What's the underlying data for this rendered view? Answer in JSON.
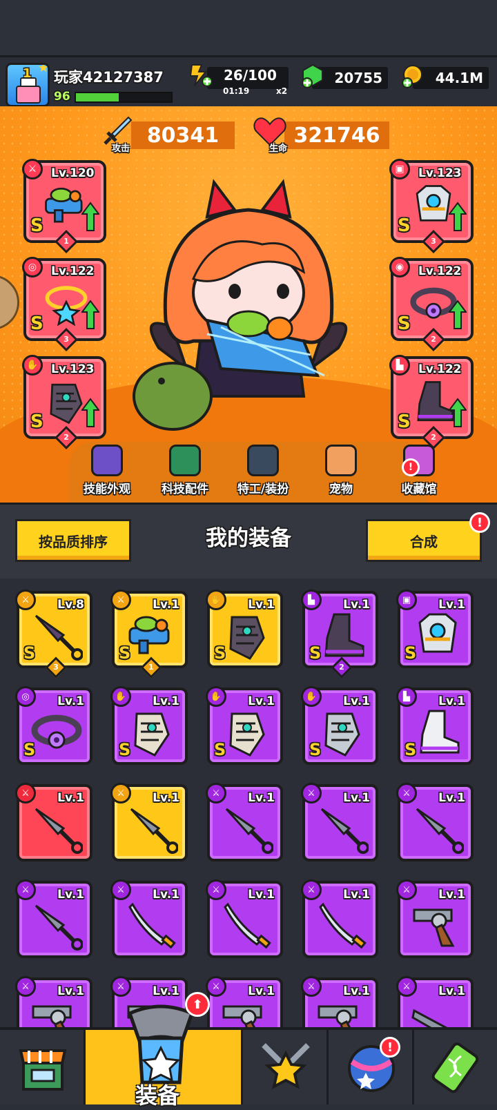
{
  "player": {
    "name": "玩家42127387",
    "level": "96",
    "xp_fraction": 0.45,
    "avatar_level": "1"
  },
  "resources": {
    "energy": {
      "value": "26/100",
      "timer": "01:19",
      "multiplier": "x2"
    },
    "gems": {
      "value": "20755"
    },
    "coins": {
      "value": "44.1M"
    }
  },
  "stats": {
    "attack": {
      "value": "80341",
      "label": "攻击"
    },
    "hp": {
      "value": "321746",
      "label": "生命"
    }
  },
  "equipped": [
    {
      "slot": "weapon",
      "level": "Lv.120",
      "grade": "S",
      "stars": "1",
      "icon": "water-gun-icon",
      "cat_icon": "sword-icon"
    },
    {
      "slot": "necklace",
      "level": "Lv.122",
      "grade": "S",
      "stars": "3",
      "icon": "star-necklace-icon",
      "cat_icon": "necklace-icon"
    },
    {
      "slot": "gloves",
      "level": "Lv.123",
      "grade": "S",
      "stars": "2",
      "icon": "gauntlet-icon",
      "cat_icon": "glove-icon"
    },
    {
      "slot": "armor",
      "level": "Lv.123",
      "grade": "S",
      "stars": "3",
      "icon": "mech-armor-icon",
      "cat_icon": "shirt-icon"
    },
    {
      "slot": "belt",
      "level": "Lv.122",
      "grade": "S",
      "stars": "2",
      "icon": "belt-icon",
      "cat_icon": "belt-icon"
    },
    {
      "slot": "boots",
      "level": "Lv.122",
      "grade": "S",
      "stars": "2",
      "icon": "boot-icon",
      "cat_icon": "boot-icon"
    }
  ],
  "menu": [
    {
      "label": "技能外观",
      "icon": "skill-skin-icon"
    },
    {
      "label": "科技配件",
      "icon": "tech-part-icon"
    },
    {
      "label": "特工/装扮",
      "icon": "agent-icon"
    },
    {
      "label": "宠物",
      "icon": "pet-icon"
    },
    {
      "label": "收藏馆",
      "icon": "collection-icon"
    }
  ],
  "equipment_panel": {
    "sort_label": "按品质排序",
    "title": "我的装备",
    "merge_label": "合成",
    "merge_alert": "!"
  },
  "inventory": [
    {
      "level": "Lv.8",
      "rarity": "gold",
      "grade": "S",
      "stars": "3",
      "icon": "dark-kunai-icon"
    },
    {
      "level": "Lv.1",
      "rarity": "gold",
      "grade": "S",
      "stars": "1",
      "icon": "water-gun-icon"
    },
    {
      "level": "Lv.1",
      "rarity": "gold",
      "grade": "S",
      "stars": "",
      "icon": "gauntlet-icon"
    },
    {
      "level": "Lv.1",
      "rarity": "purple",
      "grade": "S",
      "stars": "2",
      "icon": "boot-icon"
    },
    {
      "level": "Lv.1",
      "rarity": "purple",
      "grade": "S",
      "stars": "",
      "icon": "mech-armor-icon"
    },
    {
      "level": "Lv.1",
      "rarity": "purple",
      "grade": "S",
      "stars": "",
      "icon": "belt-icon"
    },
    {
      "level": "Lv.1",
      "rarity": "purple",
      "grade": "S",
      "stars": "",
      "icon": "tech-glove-icon"
    },
    {
      "level": "Lv.1",
      "rarity": "purple",
      "grade": "S",
      "stars": "",
      "icon": "tech-glove-icon"
    },
    {
      "level": "Lv.1",
      "rarity": "purple",
      "grade": "S",
      "stars": "",
      "icon": "silver-glove-icon"
    },
    {
      "level": "Lv.1",
      "rarity": "purple",
      "grade": "S",
      "stars": "",
      "icon": "sneaker-icon"
    },
    {
      "level": "Lv.1",
      "rarity": "red",
      "grade": "",
      "stars": "",
      "icon": "kunai-icon"
    },
    {
      "level": "Lv.1",
      "rarity": "gold",
      "grade": "",
      "stars": "",
      "icon": "kunai-icon"
    },
    {
      "level": "Lv.1",
      "rarity": "purple",
      "grade": "",
      "stars": "",
      "icon": "kunai-icon"
    },
    {
      "level": "Lv.1",
      "rarity": "purple",
      "grade": "",
      "stars": "",
      "icon": "kunai-icon"
    },
    {
      "level": "Lv.1",
      "rarity": "purple",
      "grade": "",
      "stars": "",
      "icon": "kunai-icon"
    },
    {
      "level": "Lv.1",
      "rarity": "purple",
      "grade": "",
      "stars": "",
      "icon": "kunai-icon"
    },
    {
      "level": "Lv.1",
      "rarity": "purple",
      "grade": "",
      "stars": "",
      "icon": "katana-icon"
    },
    {
      "level": "Lv.1",
      "rarity": "purple",
      "grade": "",
      "stars": "",
      "icon": "katana-icon"
    },
    {
      "level": "Lv.1",
      "rarity": "purple",
      "grade": "",
      "stars": "",
      "icon": "katana-icon"
    },
    {
      "level": "Lv.1",
      "rarity": "purple",
      "grade": "",
      "stars": "",
      "icon": "revolver-icon"
    },
    {
      "level": "Lv.1",
      "rarity": "purple",
      "grade": "",
      "stars": "",
      "icon": "revolver-icon"
    },
    {
      "level": "Lv.1",
      "rarity": "purple",
      "grade": "",
      "stars": "",
      "icon": "revolver-icon"
    },
    {
      "level": "Lv.1",
      "rarity": "purple",
      "grade": "",
      "stars": "",
      "icon": "revolver-icon"
    },
    {
      "level": "Lv.1",
      "rarity": "purple",
      "grade": "",
      "stars": "",
      "icon": "revolver-icon"
    },
    {
      "level": "Lv.1",
      "rarity": "purple",
      "grade": "",
      "stars": "",
      "icon": "shotgun-icon"
    }
  ],
  "nav": {
    "tabs": [
      {
        "name": "shop",
        "icon": "shop-icon"
      },
      {
        "name": "equipment",
        "icon": "equipment-icon",
        "label": "装备"
      },
      {
        "name": "battle",
        "icon": "crossed-swords-star-icon"
      },
      {
        "name": "world",
        "icon": "planet-icon",
        "alert": "!"
      },
      {
        "name": "lab",
        "icon": "dna-battery-icon"
      }
    ],
    "equip_alert": "⬆"
  },
  "colors": {
    "gold": "#ffc818",
    "purple": "#b23cf0",
    "red": "#ff4656",
    "orange_bg": "#ff9a1e"
  }
}
